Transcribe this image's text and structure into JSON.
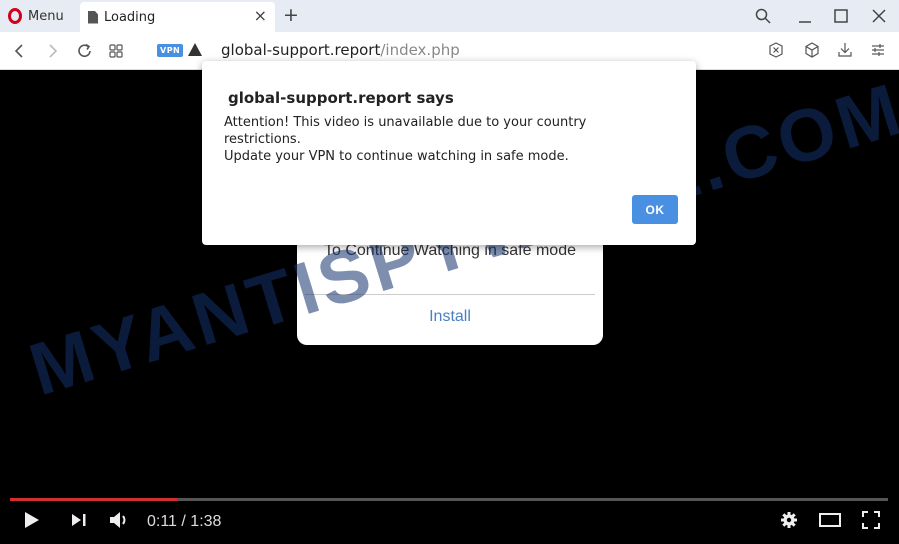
{
  "browser": {
    "menu_label": "Menu",
    "tab": {
      "title": "Loading",
      "close": "×"
    },
    "new_tab": "+",
    "window_controls": {
      "search": "⚲",
      "minimize": "_",
      "maximize": "☐",
      "close": "✕"
    },
    "nav": {
      "back": "‹",
      "forward": "›",
      "reload": "↻",
      "tabs_grid": "⊞"
    },
    "vpn_badge": "VPN",
    "url": {
      "host": "global-support.report",
      "path": "/index.php"
    },
    "extensions": {
      "adblock": "⊗",
      "cube": "⬡",
      "download": "⤓",
      "easy_setup": "☰"
    }
  },
  "dialog": {
    "title": "global-support.report says",
    "message_lines": [
      "Attention! This video is unavailable due to your country restrictions.",
      "Update your VPN to continue watching in safe mode."
    ],
    "ok_label": "OK"
  },
  "install_card": {
    "title": "To Continue Watching in safe mode",
    "install_label": "Install"
  },
  "watermark": "MYANTISPYWARE.COM",
  "player": {
    "current_time": "0:11",
    "duration": "1:38",
    "time_display": "0:11 / 1:38",
    "progress_fraction": 0.19,
    "icons": {
      "play": "▶",
      "next": "⏭",
      "volume": "🔊",
      "settings": "⚙",
      "theater": "▭",
      "fullscreen": "⛶"
    }
  },
  "colors": {
    "accent": "#4a90e2",
    "progress": "#d32f2f",
    "opera_red": "#d0021b",
    "link": "#4a7fc1"
  }
}
